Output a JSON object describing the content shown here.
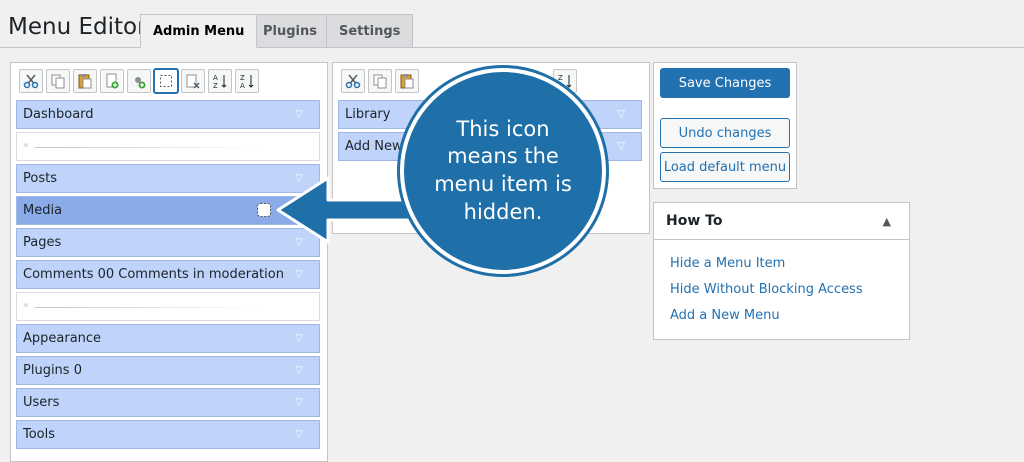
{
  "page": {
    "title": "Menu Editor"
  },
  "tabs": [
    {
      "label": "Admin Menu",
      "active": true
    },
    {
      "label": "Plugins",
      "active": false
    },
    {
      "label": "Settings",
      "active": false
    }
  ],
  "left_toolbar": [
    "cut-icon",
    "copy-icon",
    "paste-icon",
    "new-menu-icon",
    "new-separator-icon",
    "hide-icon",
    "delete-icon",
    "sort-ascending-icon",
    "sort-descending-icon"
  ],
  "menu_items": [
    {
      "label": "Dashboard",
      "type": "item"
    },
    {
      "label": "",
      "type": "separator"
    },
    {
      "label": "Posts",
      "type": "item"
    },
    {
      "label": "Media",
      "type": "item",
      "selected": true,
      "hidden": true
    },
    {
      "label": "Pages",
      "type": "item"
    },
    {
      "label": "Comments 00 Comments in moderation",
      "type": "item"
    },
    {
      "label": "",
      "type": "separator"
    },
    {
      "label": "Appearance",
      "type": "item"
    },
    {
      "label": "Plugins 0",
      "type": "item"
    },
    {
      "label": "Users",
      "type": "item"
    },
    {
      "label": "Tools",
      "type": "item"
    }
  ],
  "submenu_items": [
    {
      "label": "Library"
    },
    {
      "label": "Add New"
    }
  ],
  "actions": {
    "save": "Save Changes",
    "undo": "Undo changes",
    "load_default": "Load default menu"
  },
  "howto": {
    "title": "How To",
    "links": [
      "Hide a Menu Item",
      "Hide Without Blocking Access",
      "Add a New Menu"
    ]
  },
  "callout": {
    "text": "This icon means the menu item is hidden."
  },
  "colors": {
    "accent": "#2271b1",
    "item_bg": "#bfd3fb",
    "selected_bg": "#8aaae8",
    "callout": "#1f6fa8"
  }
}
